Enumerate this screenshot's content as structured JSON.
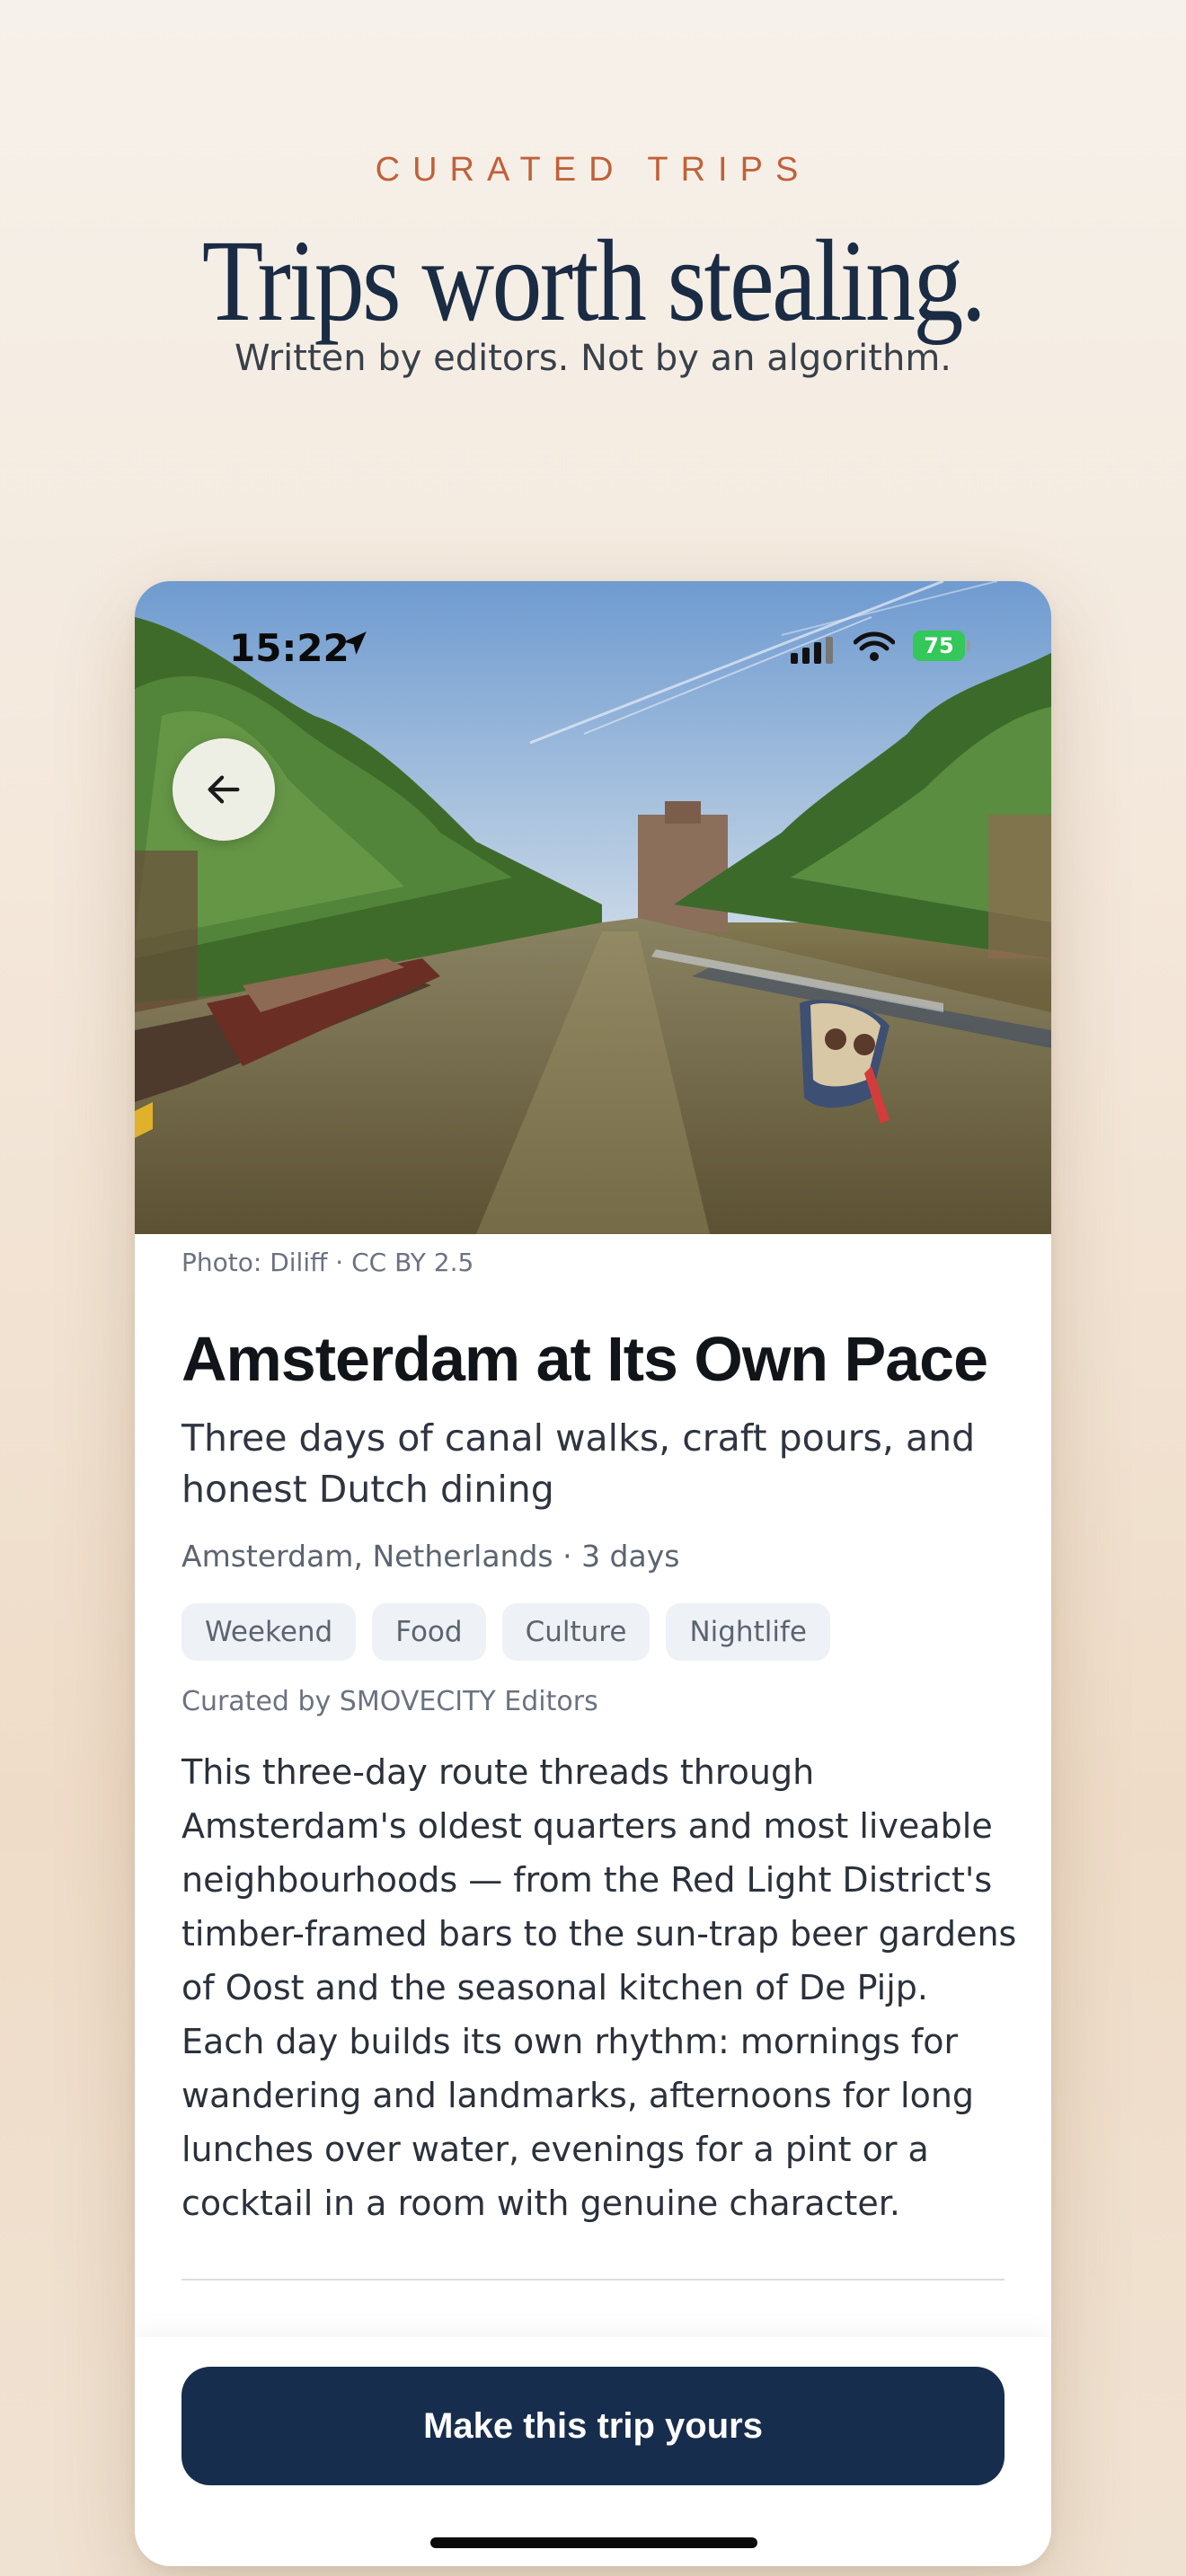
{
  "header": {
    "eyebrow": "CURATED TRIPS",
    "headline": "Trips worth stealing.",
    "subhead": "Written by editors. Not by an algorithm."
  },
  "status_bar": {
    "time": "15:22",
    "battery": "75"
  },
  "trip": {
    "photo_credit": "Photo: Diliff · CC BY 2.5",
    "title": "Amsterdam at Its Own Pace",
    "tagline": "Three days of canal walks, craft pours, and honest Dutch dining",
    "meta": "Amsterdam, Netherlands · 3 days",
    "tags": [
      "Weekend",
      "Food",
      "Culture",
      "Nightlife"
    ],
    "curator": "Curated by SMOVECITY Editors",
    "description": "This three-day route threads through Amsterdam's oldest quarters and most liveable neighbourhoods — from the Red Light District's timber-framed bars to the sun-trap beer gardens of Oost and the seasonal kitchen of De Pijp. Each day builds its own rhythm: mornings for wandering and landmarks, afternoons for long lunches over water, evenings for a pint or a cocktail in a room with genuine character."
  },
  "cta": {
    "label": "Make this trip yours"
  },
  "colors": {
    "accent": "#c0613a",
    "navy": "#172d4d",
    "battery": "#34c759"
  }
}
